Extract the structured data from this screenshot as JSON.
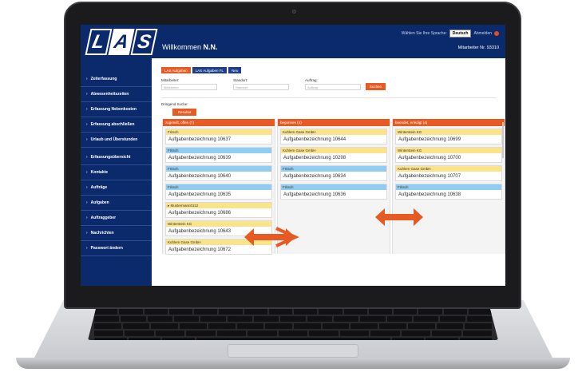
{
  "app": {
    "logo_letters": [
      "L",
      "A",
      "S"
    ],
    "welcome_prefix": "Willkommen",
    "user_name": "N.N.",
    "lang_prompt": "Wählen Sie Ihre Sprache:",
    "lang_selected": "Deutsch",
    "logout_label": "Abmelden",
    "employee_label": "Mitarbeiter Nr. 93310"
  },
  "sidebar": {
    "items": [
      {
        "label": "Zeiterfassung"
      },
      {
        "label": "Abwesenheitszeiten"
      },
      {
        "label": "Erfassung Nebenkosten"
      },
      {
        "label": "Erfassung abschließen"
      },
      {
        "label": "Urlaub und Überstunden"
      },
      {
        "label": "Erfassungsübersicht"
      },
      {
        "label": "Kontakte"
      },
      {
        "label": "Aufträge"
      },
      {
        "label": "Aufgaben"
      },
      {
        "label": "Auftraggeber"
      },
      {
        "label": "Nachrichten"
      },
      {
        "label": "Passwort ändern"
      }
    ]
  },
  "main": {
    "tabs": [
      {
        "label": "LAS Aufgaben"
      },
      {
        "label": "LAS Aufgaben FL"
      },
      {
        "label": "Neu"
      }
    ],
    "filters": {
      "field1_label": "Mitarbeiter:",
      "field1_placeholder": "Mitarbeiter",
      "field2_label": "Standort:",
      "field2_placeholder": "Standort",
      "field3_label": "Auftrag:",
      "field3_placeholder": "Auftrag",
      "search_button": "Suchen",
      "section_label": "Dringend Suche:",
      "urgent_button": "Resultat"
    },
    "columns": [
      {
        "header": "zugeteilt, offen (7)",
        "cards": [
          {
            "tag": "Fritsch",
            "color": "yellow",
            "title": "Aufgabenbezeichnung 10637"
          },
          {
            "tag": "Fritsch",
            "color": "blue",
            "title": "Aufgabenbezeichnung 10639"
          },
          {
            "tag": "Fritsch",
            "color": "blue",
            "title": "Aufgabenbezeichnung 10640"
          },
          {
            "tag": "Fritsch",
            "color": "blue",
            "title": "Aufgabenbezeichnung 10635"
          },
          {
            "tag": "▸ Mustermann0112",
            "color": "yellow",
            "title": "Aufgabenbezeichnung 10686"
          },
          {
            "tag": "Winterstein KG",
            "color": "yellow",
            "title": "Aufgabenbezeichnung 10643"
          },
          {
            "tag": "Kuhlem Gase GmbH",
            "color": "yellow",
            "title": "Aufgabenbezeichnung 10672"
          }
        ]
      },
      {
        "header": "begonnen (4)",
        "cards": [
          {
            "tag": "Kuhlem Gase GmbH",
            "color": "yellow",
            "title": "Aufgabenbezeichnung 10644"
          },
          {
            "tag": "Kuhlem Gase GmbH",
            "color": "yellow",
            "title": "Aufgabenbezeichnung 10298"
          },
          {
            "tag": "Fritsch",
            "color": "blue",
            "title": "Aufgabenbezeichnung 10634"
          },
          {
            "tag": "Fritsch",
            "color": "blue",
            "title": "Aufgabenbezeichnung 10636"
          }
        ]
      },
      {
        "header": "beendet, erledigt (4)",
        "cards": [
          {
            "tag": "Winterstein KG",
            "color": "yellow",
            "title": "Aufgabenbezeichnung 10699"
          },
          {
            "tag": "Winterstein KG",
            "color": "yellow",
            "title": "Aufgabenbezeichnung 10700"
          },
          {
            "tag": "Kuhlem Gase GmbH",
            "color": "yellow",
            "title": "Aufgabenbezeichnung 10707"
          },
          {
            "tag": "Fritsch",
            "color": "blue",
            "title": "Aufgabenbezeichnung 10638"
          }
        ]
      }
    ]
  },
  "colors": {
    "navy": "#0b2a6b",
    "orange": "#e85a23",
    "tag_yellow": "#fbe38a",
    "tag_blue": "#8fcdf2"
  }
}
